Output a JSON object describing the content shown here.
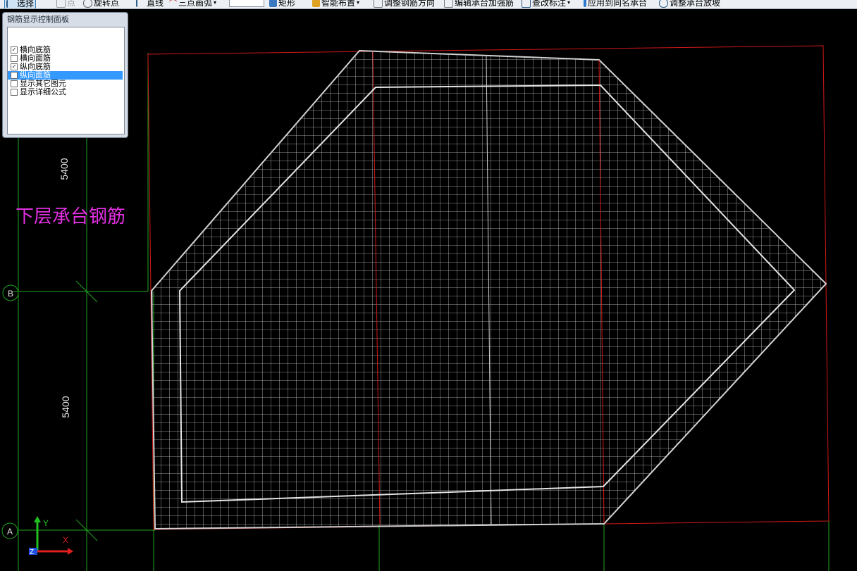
{
  "toolbar": {
    "items": [
      {
        "label": "选择",
        "icon": "select-arrow-icon",
        "active": true
      },
      {
        "label": "点",
        "icon": "point-icon"
      },
      {
        "label": "旋转点",
        "icon": "rotate-point-icon"
      },
      {
        "label": "直线",
        "icon": "line-icon"
      },
      {
        "label": "三点画弧",
        "icon": "arc-icon",
        "dropdown": true
      },
      {
        "label": "矩形",
        "icon": "rectangle-icon"
      },
      {
        "label": "智能布置",
        "icon": "smart-place-icon",
        "dropdown": true
      },
      {
        "label": "调整钢筋方向",
        "icon": "rebar-direction-icon"
      },
      {
        "label": "编辑承台加强筋",
        "icon": "edit-rebar-icon"
      },
      {
        "label": "查改标注",
        "icon": "edit-dimension-icon",
        "dropdown": true
      },
      {
        "label": "应用到同名承台",
        "icon": "apply-icon"
      },
      {
        "label": "调整承台放坡",
        "icon": "slope-icon"
      }
    ]
  },
  "panel": {
    "title": "钢筋显示控制面板",
    "options": [
      {
        "label": "横向底筋",
        "checked": true
      },
      {
        "label": "横向面筋",
        "checked": false
      },
      {
        "label": "纵向底筋",
        "checked": true
      },
      {
        "label": "纵向面筋",
        "checked": false,
        "selected": true
      },
      {
        "label": "显示其它图元",
        "checked": false
      },
      {
        "label": "显示详细公式",
        "checked": false
      }
    ]
  },
  "canvas": {
    "layer_label": "下层承台钢筋",
    "dimensions": [
      "5400",
      "5400"
    ],
    "axis_labels": [
      "B",
      "A"
    ],
    "ucs": {
      "x_label": "X",
      "y_label": "Y",
      "z_label": "Z"
    },
    "colors": {
      "background": "#000000",
      "grid_line": "#1fa31f",
      "red_outline": "#d01818",
      "rebar": "#cfcfcf",
      "label_magenta": "#e030e0"
    }
  }
}
